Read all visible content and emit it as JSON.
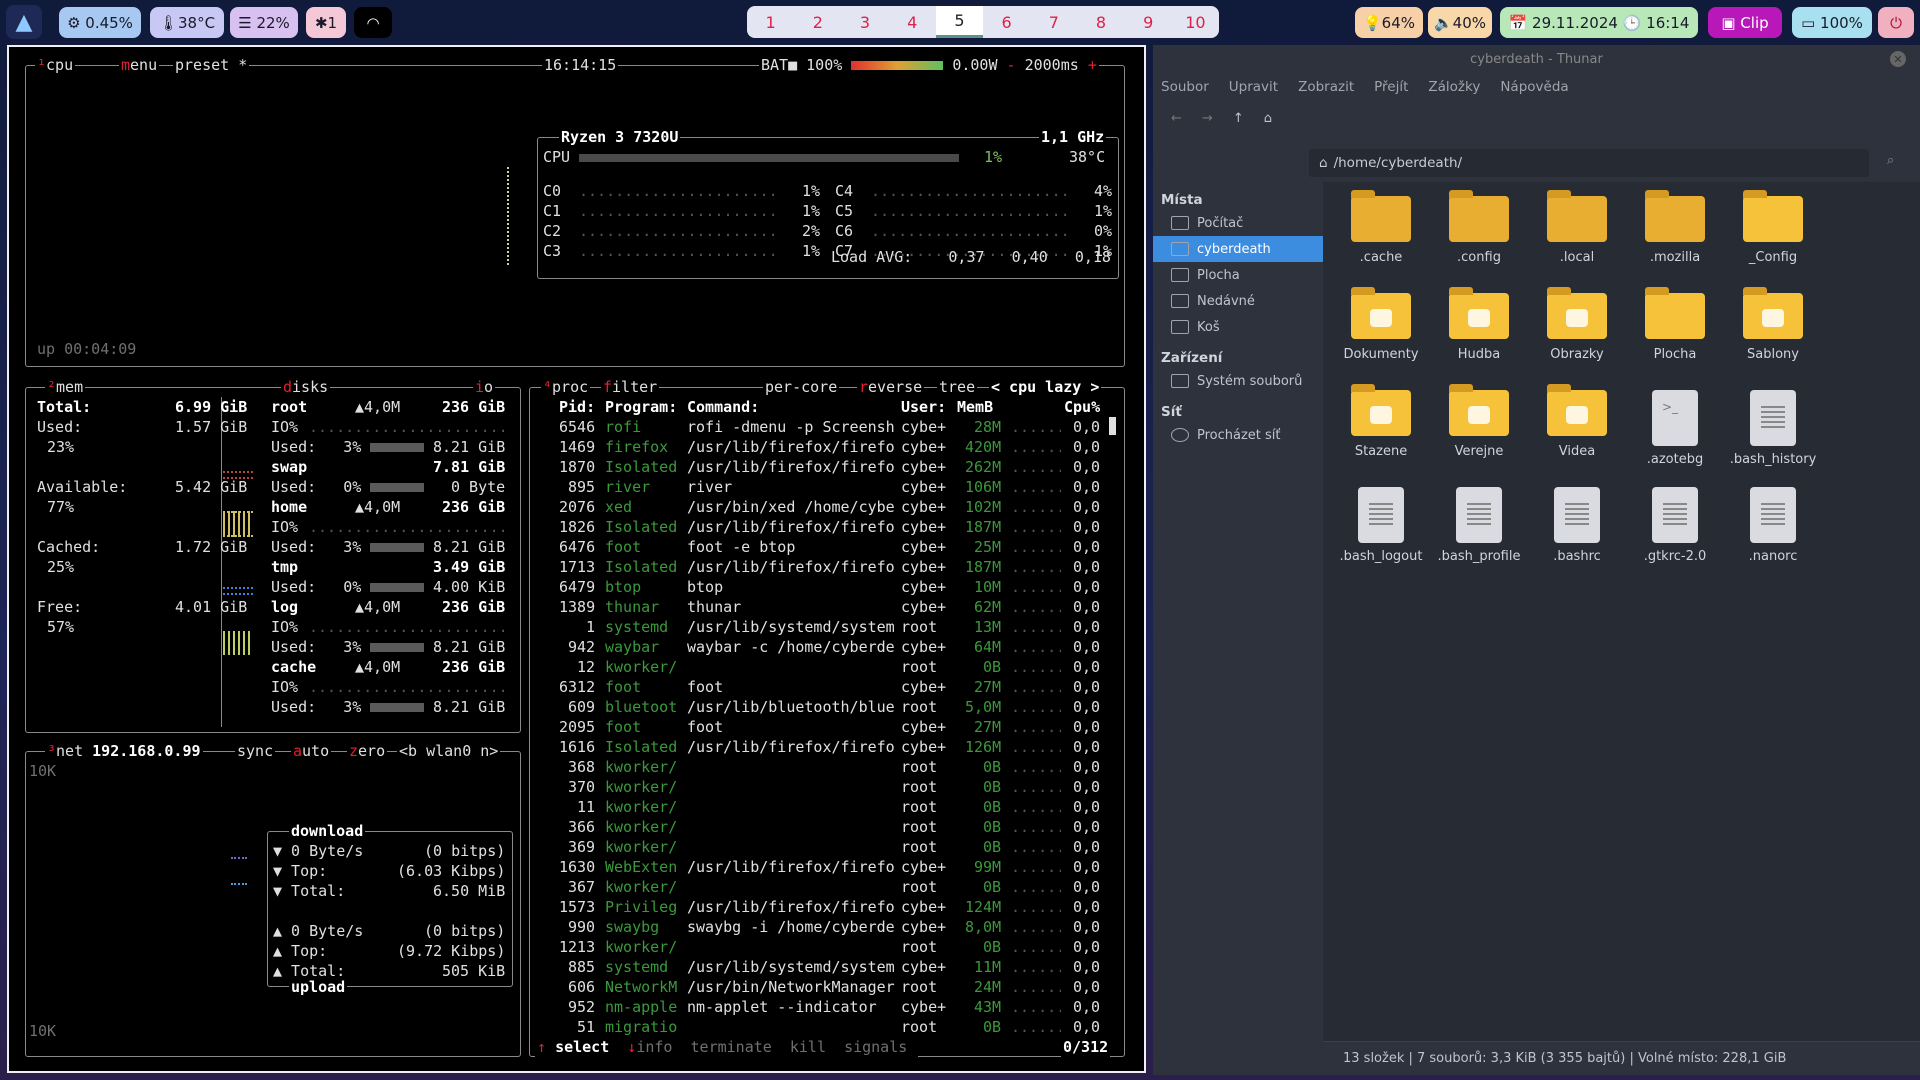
{
  "bar": {
    "cpu": "0.45%",
    "temp": "38°C",
    "mem": "22%",
    "bt": "1",
    "workspaces": [
      "1",
      "2",
      "3",
      "4",
      "5",
      "6",
      "7",
      "8",
      "9",
      "10"
    ],
    "active_ws": 4,
    "bright": "64%",
    "vol": "40%",
    "date": "29.11.2024",
    "time": "16:14",
    "clip": "Clip",
    "battery": "100%"
  },
  "btop": {
    "cpu_tab": "cpu",
    "menu": "menu",
    "preset": "preset *",
    "clock": "16:14:15",
    "bat_label": "BAT",
    "bat_pct": "100%",
    "watts": "0.00W",
    "interval": "2000ms",
    "cpu_model": "Ryzen 3 7320U",
    "freq": "1,1 GHz",
    "cpu_label": "CPU",
    "cpu_pct": "1%",
    "cpu_temp": "38°C",
    "cores": [
      {
        "n": "C0",
        "v": "1%"
      },
      {
        "n": "C1",
        "v": "1%"
      },
      {
        "n": "C2",
        "v": "2%"
      },
      {
        "n": "C3",
        "v": "1%"
      },
      {
        "n": "C4",
        "v": "4%"
      },
      {
        "n": "C5",
        "v": "1%"
      },
      {
        "n": "C6",
        "v": "0%"
      },
      {
        "n": "C7",
        "v": "1%"
      }
    ],
    "load_label": "Load AVG:",
    "load": [
      "0,37",
      "0,40",
      "0,18"
    ],
    "uptime": "up 00:04:09",
    "mem": {
      "title": "mem",
      "total_l": "Total:",
      "total": "6.99 GiB",
      "used_l": "Used:",
      "used": "1.57 GiB",
      "used_p": "23%",
      "avail_l": "Available:",
      "avail": "5.42 GiB",
      "avail_p": "77%",
      "cached_l": "Cached:",
      "cached": "1.72 GiB",
      "cached_p": "25%",
      "free_l": "Free:",
      "free": "4.01 GiB",
      "free_p": "57%"
    },
    "disks_title": "disks",
    "io_title": "io",
    "disks": [
      {
        "name": "root",
        "io": "▲4,0M",
        "size": "236 GiB",
        "iop": "IO%",
        "used": "3%",
        "usedv": "8.21 GiB"
      },
      {
        "name": "swap",
        "size": "7.81 GiB",
        "used": "0%",
        "usedv": "0 Byte"
      },
      {
        "name": "home",
        "io": "▲4,0M",
        "size": "236 GiB",
        "iop": "IO%",
        "used": "3%",
        "usedv": "8.21 GiB"
      },
      {
        "name": "tmp",
        "size": "3.49 GiB",
        "used": "0%",
        "usedv": "4.00 KiB"
      },
      {
        "name": "log",
        "io": "▲4,0M",
        "size": "236 GiB",
        "iop": "IO%",
        "used": "3%",
        "usedv": "8.21 GiB"
      },
      {
        "name": "cache",
        "io": "▲4,0M",
        "size": "236 GiB",
        "iop": "IO%",
        "used": "3%",
        "usedv": "8.21 GiB"
      }
    ],
    "used_label": "Used:",
    "net": {
      "title": "net",
      "ip": "192.168.0.99",
      "sync": "sync",
      "auto": "auto",
      "zero": "zero",
      "iface": "<b wlan0 n>",
      "scale_top": "10K",
      "scale_bot": "10K",
      "download": "download",
      "upload": "upload",
      "dl": [
        [
          "▼ 0 Byte/s",
          "(0 bitps)"
        ],
        [
          "▼ Top:",
          "(6.03 Kibps)"
        ],
        [
          "▼ Total:",
          "6.50 MiB"
        ]
      ],
      "ul": [
        [
          "▲ 0 Byte/s",
          "(0 bitps)"
        ],
        [
          "▲ Top:",
          "(9.72 Kibps)"
        ],
        [
          "▲ Total:",
          "505 KiB"
        ]
      ]
    },
    "proc": {
      "title": "proc",
      "filter": "filter",
      "percore": "per-core",
      "reverse": "reverse",
      "tree": "tree",
      "sort": "< cpu lazy >",
      "headers": [
        "Pid:",
        "Program:",
        "Command:",
        "User:",
        "MemB",
        "Cpu%"
      ],
      "rows": [
        [
          "6546",
          "rofi",
          "rofi -dmenu -p Screensh",
          "cybe+",
          "28M",
          "0,0"
        ],
        [
          "1469",
          "firefox",
          "/usr/lib/firefox/firefo",
          "cybe+",
          "420M",
          "0,0"
        ],
        [
          "1870",
          "Isolated",
          "/usr/lib/firefox/firefo",
          "cybe+",
          "262M",
          "0,0"
        ],
        [
          "895",
          "river",
          "river",
          "cybe+",
          "106M",
          "0,0"
        ],
        [
          "2076",
          "xed",
          "/usr/bin/xed /home/cybe",
          "cybe+",
          "102M",
          "0,0"
        ],
        [
          "1826",
          "Isolated",
          "/usr/lib/firefox/firefo",
          "cybe+",
          "187M",
          "0,0"
        ],
        [
          "6476",
          "foot",
          "foot -e btop",
          "cybe+",
          "25M",
          "0,0"
        ],
        [
          "1713",
          "Isolated",
          "/usr/lib/firefox/firefo",
          "cybe+",
          "187M",
          "0,0"
        ],
        [
          "6479",
          "btop",
          "btop",
          "cybe+",
          "10M",
          "0,0"
        ],
        [
          "1389",
          "thunar",
          "thunar",
          "cybe+",
          "62M",
          "0,0"
        ],
        [
          "1",
          "systemd",
          "/usr/lib/systemd/system",
          "root",
          "13M",
          "0,0"
        ],
        [
          "942",
          "waybar",
          "waybar -c /home/cyberde",
          "cybe+",
          "64M",
          "0,0"
        ],
        [
          "12",
          "kworker/",
          "",
          "root",
          "0B",
          "0,0"
        ],
        [
          "6312",
          "foot",
          "foot",
          "cybe+",
          "27M",
          "0,0"
        ],
        [
          "609",
          "bluetoot",
          "/usr/lib/bluetooth/blue",
          "root",
          "5,0M",
          "0,0"
        ],
        [
          "2095",
          "foot",
          "foot",
          "cybe+",
          "27M",
          "0,0"
        ],
        [
          "1616",
          "Isolated",
          "/usr/lib/firefox/firefo",
          "cybe+",
          "126M",
          "0,0"
        ],
        [
          "368",
          "kworker/",
          "",
          "root",
          "0B",
          "0,0"
        ],
        [
          "370",
          "kworker/",
          "",
          "root",
          "0B",
          "0,0"
        ],
        [
          "11",
          "kworker/",
          "",
          "root",
          "0B",
          "0,0"
        ],
        [
          "366",
          "kworker/",
          "",
          "root",
          "0B",
          "0,0"
        ],
        [
          "369",
          "kworker/",
          "",
          "root",
          "0B",
          "0,0"
        ],
        [
          "1630",
          "WebExten",
          "/usr/lib/firefox/firefo",
          "cybe+",
          "99M",
          "0,0"
        ],
        [
          "367",
          "kworker/",
          "",
          "root",
          "0B",
          "0,0"
        ],
        [
          "1573",
          "Privileg",
          "/usr/lib/firefox/firefo",
          "cybe+",
          "124M",
          "0,0"
        ],
        [
          "990",
          "swaybg",
          "swaybg -i /home/cyberde",
          "cybe+",
          "8,0M",
          "0,0"
        ],
        [
          "1213",
          "kworker/",
          "",
          "root",
          "0B",
          "0,0"
        ],
        [
          "885",
          "systemd",
          "/usr/lib/systemd/system",
          "cybe+",
          "11M",
          "0,0"
        ],
        [
          "606",
          "NetworkM",
          "/usr/bin/NetworkManager",
          "root",
          "24M",
          "0,0"
        ],
        [
          "952",
          "nm-apple",
          "nm-applet --indicator",
          "cybe+",
          "43M",
          "0,0"
        ],
        [
          "51",
          "migratio",
          "",
          "root",
          "0B",
          "0,0"
        ]
      ],
      "footer": [
        "select",
        "info",
        "terminate",
        "kill",
        "signals"
      ],
      "count": "0/312"
    }
  },
  "thunar": {
    "title": "cyberdeath - Thunar",
    "menu": [
      "Soubor",
      "Upravit",
      "Zobrazit",
      "Přejít",
      "Záložky",
      "Nápověda"
    ],
    "path": "/home/cyberdeath/",
    "places_h": "Místa",
    "places": [
      "Počítač",
      "cyberdeath",
      "Plocha",
      "Nedávné",
      "Koš"
    ],
    "devices_h": "Zařízení",
    "devices": [
      "Systém souborů"
    ],
    "net_h": "Síť",
    "net": [
      "Procházet síť"
    ],
    "files": [
      ".cache",
      ".config",
      ".local",
      ".mozilla",
      "_Config",
      "Dokumenty",
      "Hudba",
      "Obrazky",
      "Plocha",
      "Sablony",
      "Stazene",
      "Verejne",
      "Videa",
      ".azotebg",
      ".bash_history",
      ".bash_logout",
      ".bash_profile",
      ".bashrc",
      ".gtkrc-2.0",
      ".nanorc"
    ],
    "status": "13 složek  |  7 souborů: 3,3 KiB (3 355 bajtů)  |  Volné místo: 228,1 GiB"
  }
}
